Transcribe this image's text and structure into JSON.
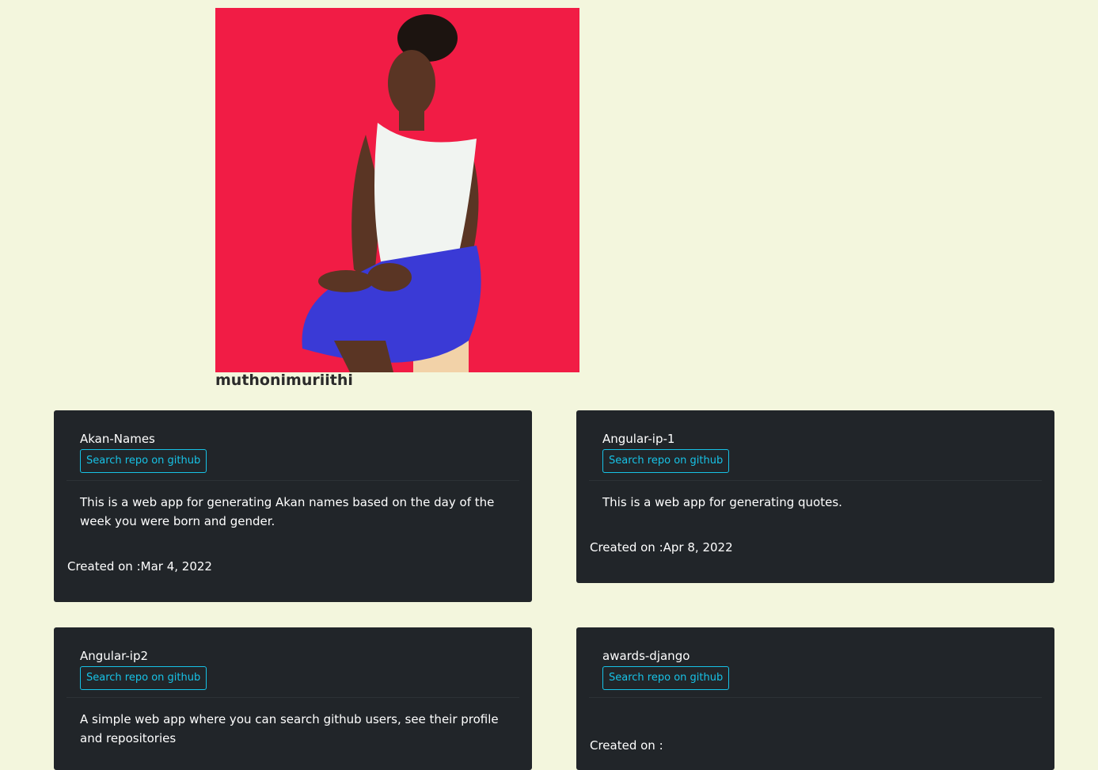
{
  "profile": {
    "username": "muthonimuriithi",
    "photo_colors": {
      "background": "#f11c45",
      "top": "#ffffff",
      "skirt": "#3a3ad6",
      "skin": "#5a3524"
    }
  },
  "repos": [
    {
      "name": "Akan-Names",
      "button_label": "Search repo on github",
      "description": "This is a web app for generating Akan names based on the day of the week you were born and gender.",
      "created_label": "Created on :",
      "created_date": "Mar 4, 2022"
    },
    {
      "name": "Angular-ip-1",
      "button_label": "Search repo on github",
      "description": "This is a web app for generating quotes.",
      "created_label": "Created on :",
      "created_date": "Apr 8, 2022"
    },
    {
      "name": "Angular-ip2",
      "button_label": "Search repo on github",
      "description": "A simple web app where you can search github users, see their profile and repositories",
      "created_label": "Created on :",
      "created_date": ""
    },
    {
      "name": "awards-django",
      "button_label": "Search repo on github",
      "description": "",
      "created_label": "Created on :",
      "created_date": ""
    }
  ],
  "colors": {
    "page_bg": "#f3f6dd",
    "card_bg": "#212529",
    "accent": "#17c2e6"
  }
}
